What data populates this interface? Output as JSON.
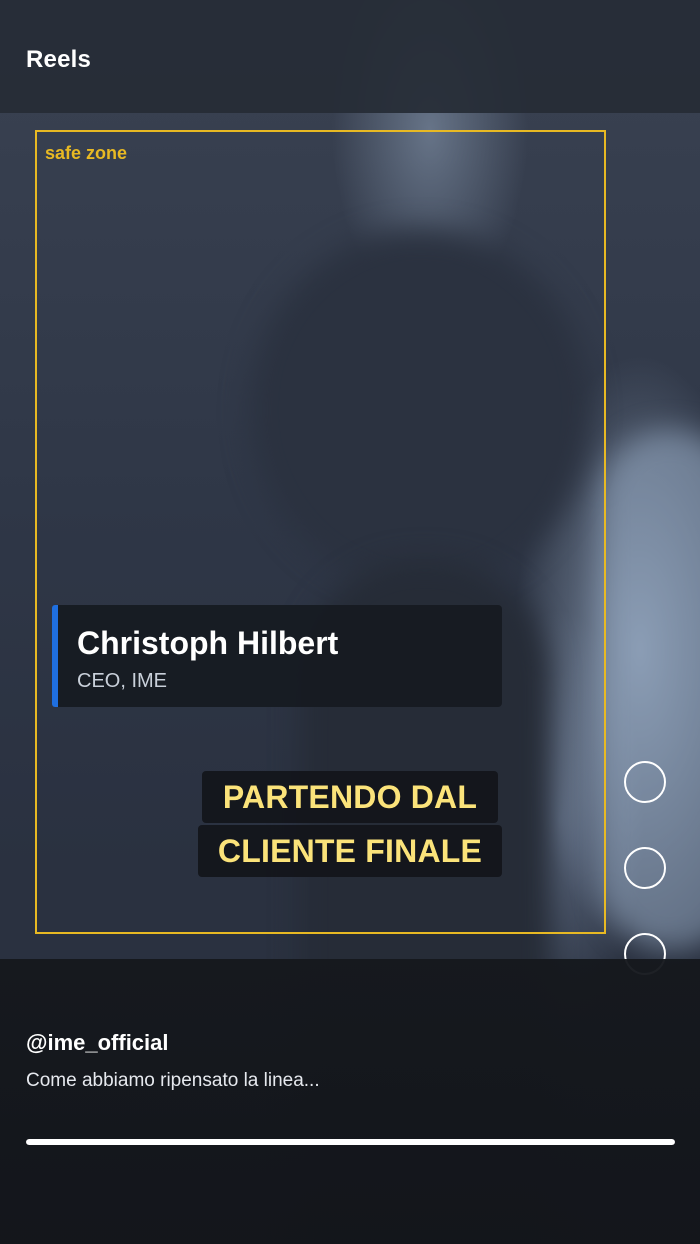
{
  "header": {
    "title": "Reels"
  },
  "overlay": {
    "safe_zone_label": "safe zone",
    "safe_zone_color": "#e8b923"
  },
  "lower_third": {
    "name": "Christoph Hilbert",
    "role": "CEO, IME",
    "accent_color": "#1f6fe0"
  },
  "captions": {
    "line_1": "PARTENDO DAL",
    "line_2": "CLIENTE FINALE",
    "text_color": "#fbe37a"
  },
  "side_actions": [
    {
      "icon": "circle-icon"
    },
    {
      "icon": "circle-icon"
    },
    {
      "icon": "circle-icon"
    }
  ],
  "post": {
    "username": "@ime_official",
    "caption": "Come abbiamo ripensato la linea..."
  },
  "playback": {
    "progress": 1.0
  }
}
